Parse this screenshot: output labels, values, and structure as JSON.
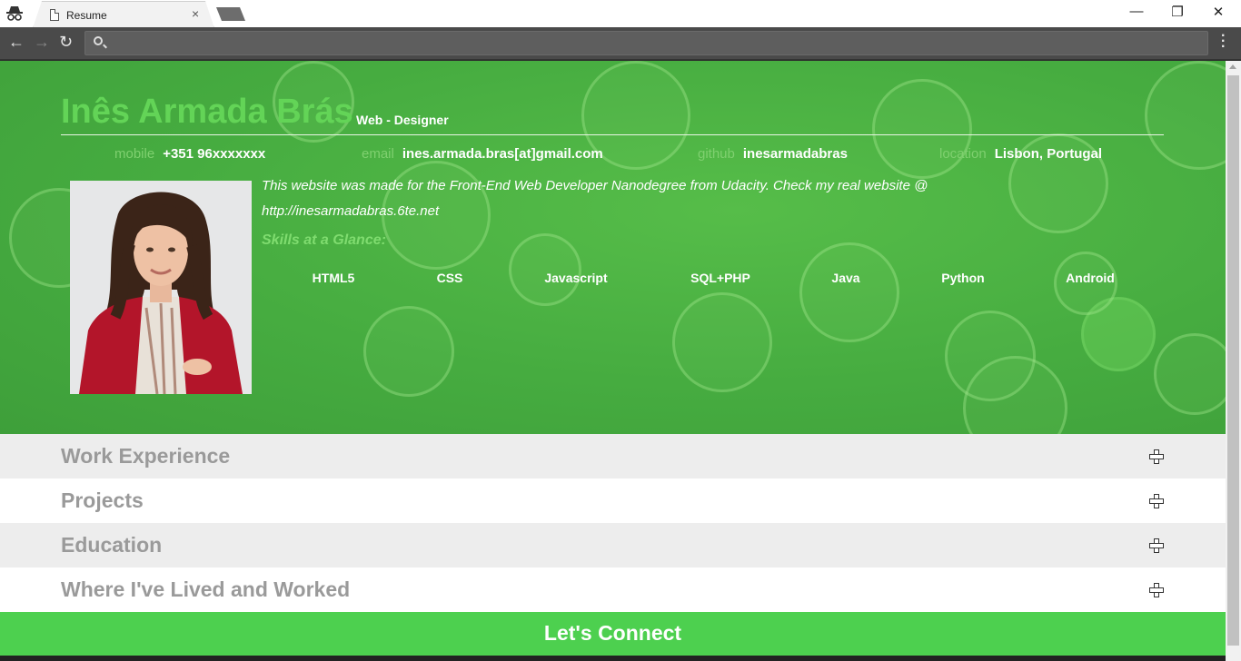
{
  "browser": {
    "tab_title": "Resume",
    "tab_close": "×",
    "url": "",
    "window_controls": {
      "minimize": "—",
      "maximize": "❐",
      "close": "✕"
    },
    "nav": {
      "back": "←",
      "forward": "→",
      "reload": "↻"
    },
    "menu": "⋮"
  },
  "header": {
    "name": "Inês Armada Brás",
    "role": "Web - Designer",
    "contacts": [
      {
        "label": "mobile",
        "value": "+351 96xxxxxxx"
      },
      {
        "label": "email",
        "value": "ines.armada.bras[at]gmail.com"
      },
      {
        "label": "github",
        "value": "inesarmadabras"
      },
      {
        "label": "location",
        "value": "Lisbon, Portugal"
      }
    ],
    "welcome": " This website was made for the Front-End Web Developer Nanodegree from Udacity. Check my real website @ http://inesarmadabras.6te.net",
    "skills_heading": "Skills at a Glance:",
    "skills": [
      "HTML5",
      "CSS",
      "Javascript",
      "SQL+PHP",
      "Java",
      "Python",
      "Android"
    ]
  },
  "sections": [
    {
      "title": "Work Experience"
    },
    {
      "title": "Projects"
    },
    {
      "title": "Education"
    },
    {
      "title": "Where I've Lived and Worked"
    }
  ],
  "connect": {
    "title": "Let's Connect"
  },
  "colors": {
    "header_green": "#46ac40",
    "name_green": "#63d457",
    "connect_green": "#4dd04f",
    "section_gray": "#ededed"
  }
}
